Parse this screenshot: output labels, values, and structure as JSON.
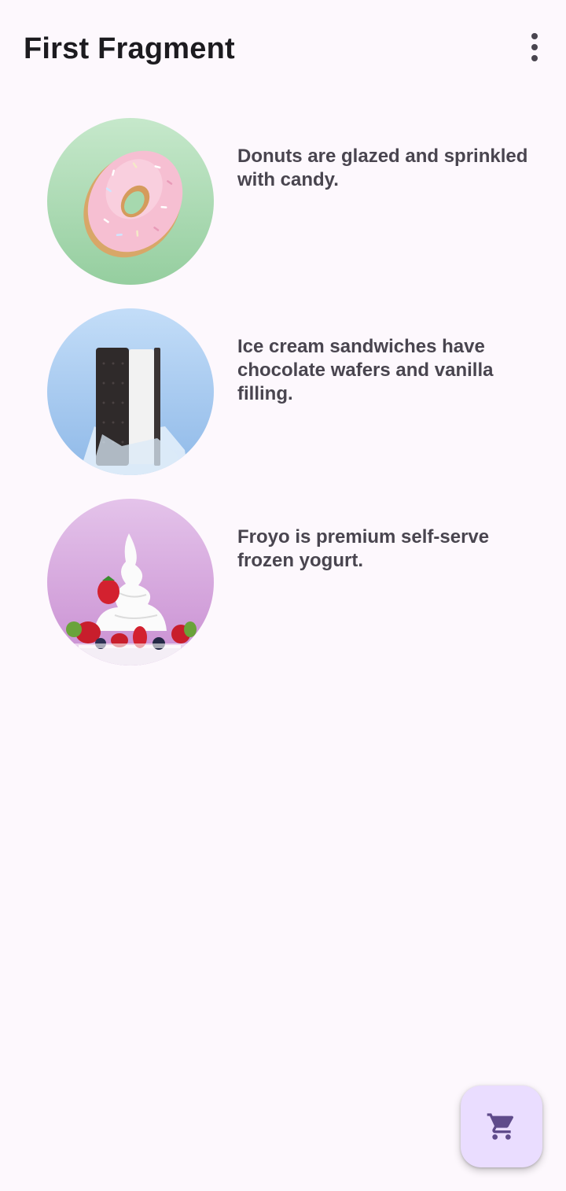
{
  "app_bar": {
    "title": "First Fragment",
    "overflow_icon": "more-vert-icon"
  },
  "desserts": [
    {
      "image": "donut-image",
      "background": "#a6d8ae",
      "description": "Donuts are glazed and sprinkled with candy."
    },
    {
      "image": "ice-cream-sandwich-image",
      "background": "#a8ccf2",
      "description": "Ice cream sandwiches have chocolate wafers and vanilla filling."
    },
    {
      "image": "froyo-image",
      "background": "#d6a7dd",
      "description": "Froyo is premium self-serve frozen yogurt."
    }
  ],
  "fab": {
    "icon": "shopping-cart-icon",
    "background": "#eaddff",
    "icon_color": "#5f4b8b"
  }
}
